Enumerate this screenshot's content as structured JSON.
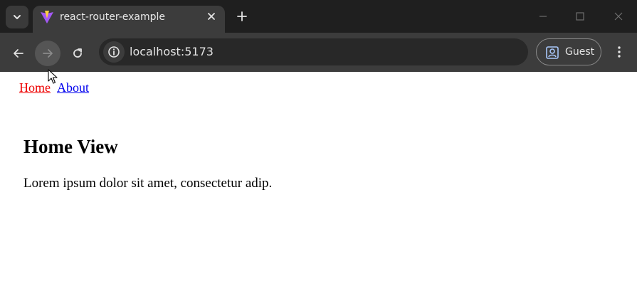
{
  "browser": {
    "tab": {
      "title": "react-router-example",
      "favicon": "vite-logo-icon"
    },
    "address_bar": {
      "url": "localhost:5173",
      "icon": "info-icon"
    },
    "profile": {
      "label": "Guest",
      "icon": "profile-icon"
    },
    "toolbar_icons": [
      "back-icon",
      "forward-icon",
      "reload-icon",
      "menu-dots-icon"
    ],
    "window_icons": [
      "minimize-icon",
      "maximize-icon",
      "close-icon"
    ]
  },
  "page": {
    "nav": {
      "home": "Home",
      "about": "About"
    },
    "heading": "Home View",
    "body": "Lorem ipsum dolor sit amet, consectetur adip."
  },
  "colors": {
    "link_active": "#ee0000",
    "link_default": "#0000ee",
    "chrome_dark": "#1f1f1f",
    "chrome_toolbar": "#3c3c3c"
  }
}
